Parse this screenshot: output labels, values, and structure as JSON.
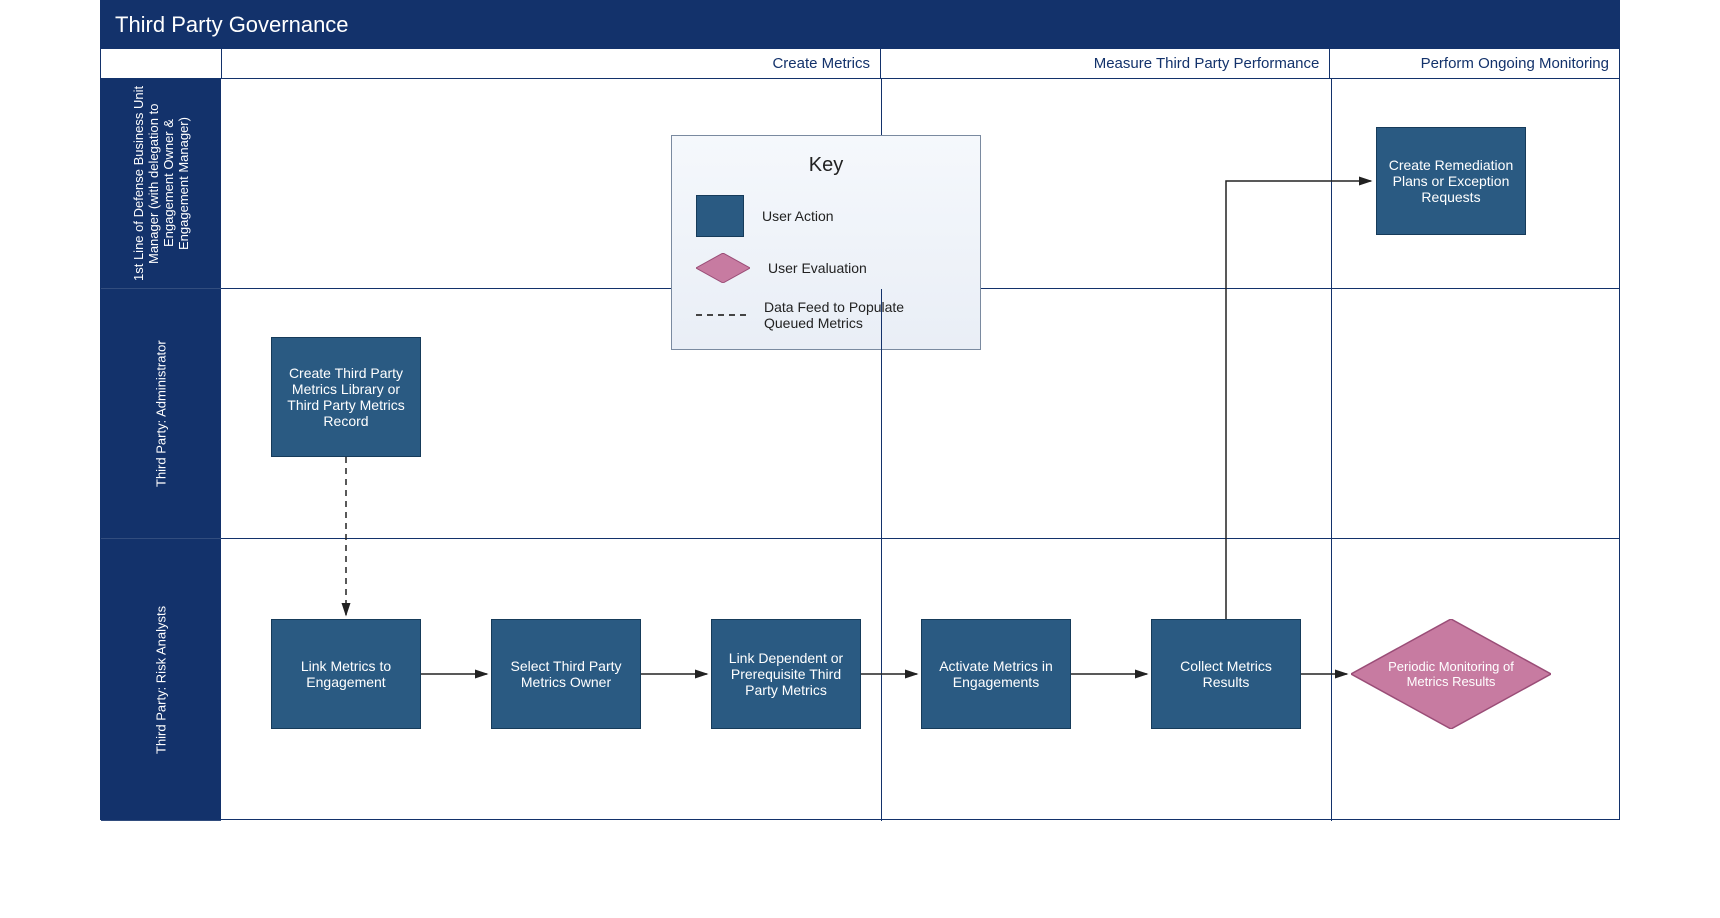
{
  "title": "Third Party Governance",
  "phases": {
    "create": "Create Metrics",
    "measure": "Measure Third Party Performance",
    "monitor": "Perform Ongoing Monitoring"
  },
  "lanes": {
    "lane1": "1st Line of Defense Business Unit Manager (with delegation to Engagement Owner & Engagement Manager)",
    "lane2": "Third Party: Administrator",
    "lane3": "Third Party: Risk Analysts"
  },
  "key": {
    "title": "Key",
    "user_action": "User Action",
    "user_evaluation": "User Evaluation",
    "data_feed": "Data Feed to Populate Queued Metrics"
  },
  "boxes": {
    "create_remediation": "Create Remediation Plans or Exception Requests",
    "create_library": "Create Third Party Metrics Library or Third Party Metrics Record",
    "link_metrics": "Link Metrics to Engagement",
    "select_owner": "Select Third Party Metrics Owner",
    "link_dependent": "Link Dependent or Prerequisite Third Party Metrics",
    "activate": "Activate Metrics in Engagements",
    "collect": "Collect Metrics Results",
    "periodic": "Periodic Monitoring of Metrics Results"
  }
}
